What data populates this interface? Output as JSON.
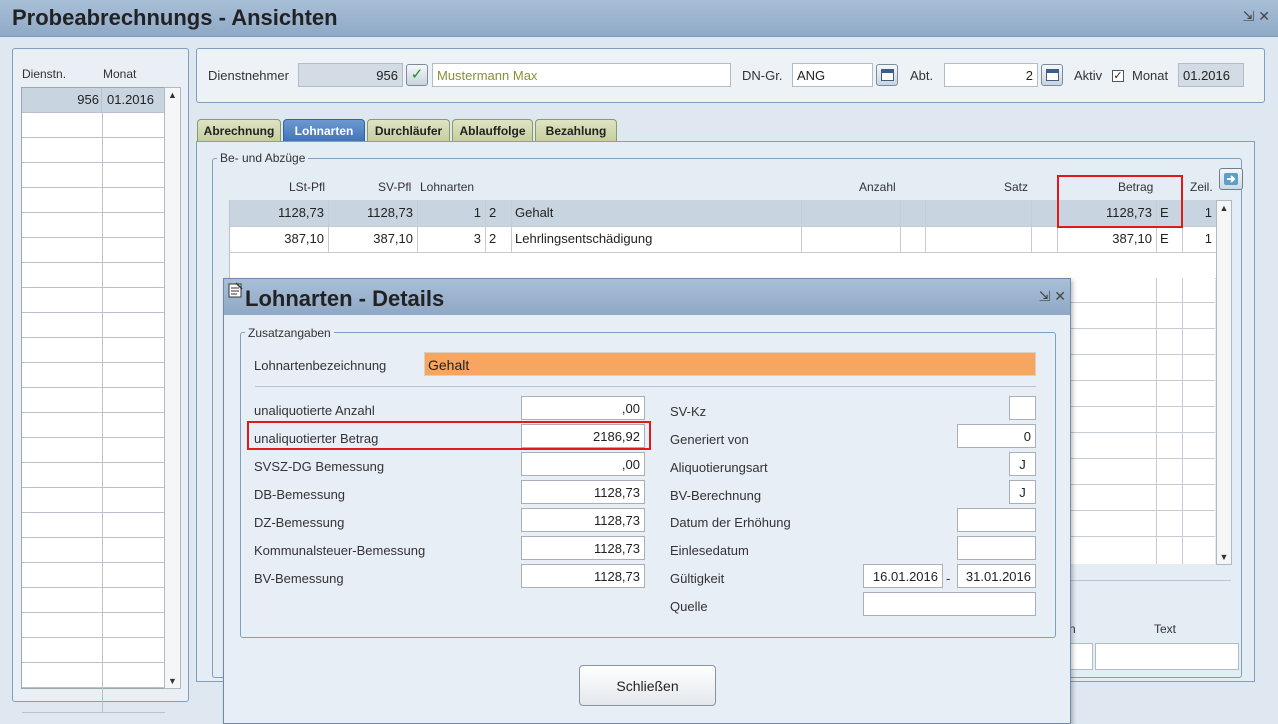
{
  "window": {
    "title": "Probeabrechnungs - Ansichten",
    "controls": "⇲ ✕"
  },
  "leftlist": {
    "col_dienstn": "Dienstn.",
    "col_monat": "Monat",
    "rows": [
      {
        "dienstn": "956",
        "monat": "01.2016"
      }
    ]
  },
  "header": {
    "dienstnehmer_label": "Dienstnehmer",
    "dienstnehmer_nr": "956",
    "dienstnehmer_name": "Mustermann Max",
    "dngr_label": "DN-Gr.",
    "dngr_value": "ANG",
    "abt_label": "Abt.",
    "abt_value": "2",
    "aktiv_label": "Aktiv",
    "aktiv_checked": "✓",
    "monat_label": "Monat",
    "monat_value": "01.2016"
  },
  "tabs": [
    {
      "label": "Abrechnung"
    },
    {
      "label": "Lohnarten"
    },
    {
      "label": "Durchläufer"
    },
    {
      "label": "Ablauffolge"
    },
    {
      "label": "Bezahlung"
    }
  ],
  "beabzuege": {
    "legend": "Be- und Abzüge",
    "columns": {
      "lstpfl": "LSt-Pfl",
      "svpfl": "SV-Pfl",
      "lohnarten": "Lohnarten",
      "anzahl": "Anzahl",
      "satz": "Satz",
      "betrag": "Betrag",
      "zeil": "Zeil."
    },
    "rows": [
      {
        "lstpfl": "1128,73",
        "svpfl": "1128,73",
        "nr": "1",
        "typ": "2",
        "bez": "Gehalt",
        "anzahl": "",
        "satz": "",
        "betrag": "1128,73",
        "e": "E",
        "zeil": "1"
      },
      {
        "lstpfl": "387,10",
        "svpfl": "387,10",
        "nr": "3",
        "typ": "2",
        "bez": "Lehrlingsentschädigung",
        "anzahl": "",
        "satz": "",
        "betrag": "387,10",
        "e": "E",
        "zeil": "1"
      }
    ],
    "bottom_text_label": "Text",
    "bottom_n_label": "n"
  },
  "dialog": {
    "title": "Lohnarten - Details",
    "controls": "⇲ ✕",
    "group_legend": "Zusatzangaben",
    "bezeichnung_label": "Lohnartenbezeichnung",
    "bezeichnung_value": "Gehalt",
    "left_fields": [
      {
        "label": "unaliquotierte Anzahl",
        "value": ",00"
      },
      {
        "label": "unaliquotierter Betrag",
        "value": "2186,92"
      },
      {
        "label": "SVSZ-DG Bemessung",
        "value": ",00"
      },
      {
        "label": "DB-Bemessung",
        "value": "1128,73"
      },
      {
        "label": "DZ-Bemessung",
        "value": "1128,73"
      },
      {
        "label": "Kommunalsteuer-Bemessung",
        "value": "1128,73"
      },
      {
        "label": "BV-Bemessung",
        "value": "1128,73"
      }
    ],
    "right_fields": {
      "svkz_label": "SV-Kz",
      "svkz_value": "",
      "generiert_label": "Generiert von",
      "generiert_value": "0",
      "aliq_label": "Aliquotierungsart",
      "aliq_value": "J",
      "bvber_label": "BV-Berechnung",
      "bvber_value": "J",
      "erhoehung_label": "Datum der Erhöhung",
      "erhoehung_value": "",
      "einlese_label": "Einlesedatum",
      "einlese_value": "",
      "gueltig_label": "Gültigkeit",
      "gueltig_von": "16.01.2016",
      "gueltig_sep": "-",
      "gueltig_bis": "31.01.2016",
      "quelle_label": "Quelle",
      "quelle_value": ""
    },
    "close_label": "Schließen"
  },
  "colors": {
    "active_tab": "#3e72b8",
    "highlight": "#e0191b",
    "bezeichnung_bg": "#f6a660"
  }
}
